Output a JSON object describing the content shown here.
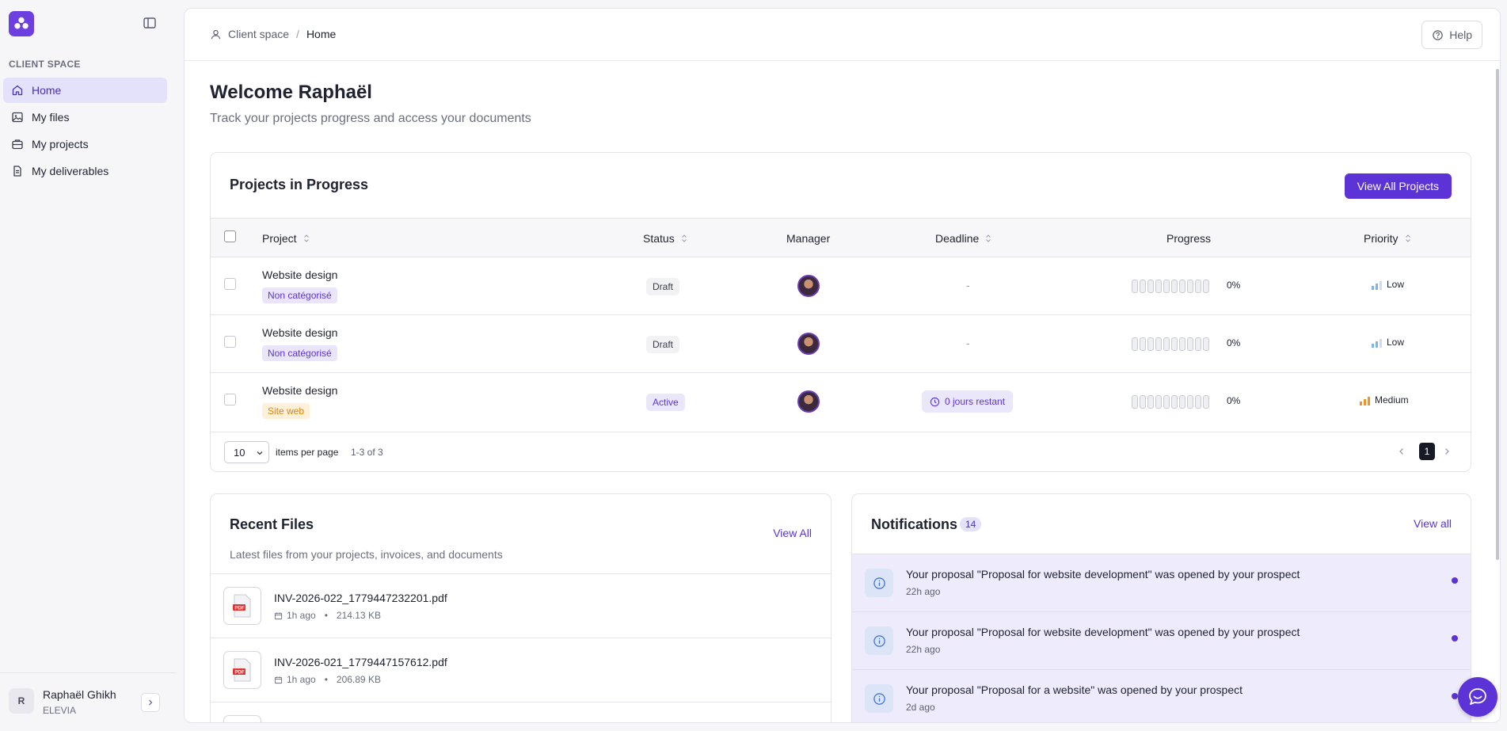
{
  "colors": {
    "accent": "#5b33d6",
    "nav_active_bg": "#e4e1fb",
    "priority_low": "#7fb4e8",
    "priority_medium": "#f39228"
  },
  "sidebar": {
    "section_label": "CLIENT SPACE",
    "items": [
      {
        "label": "Home",
        "icon": "home-icon",
        "active": true
      },
      {
        "label": "My files",
        "icon": "image-icon"
      },
      {
        "label": "My projects",
        "icon": "briefcase-icon"
      },
      {
        "label": "My deliverables",
        "icon": "document-icon"
      }
    ],
    "user": {
      "initial": "R",
      "name": "Raphaël Ghikh",
      "org": "ELEVIA"
    }
  },
  "topbar": {
    "breadcrumb": [
      "Client space",
      "Home"
    ],
    "separator": "/",
    "help_label": "Help"
  },
  "page": {
    "title": "Welcome Raphaël",
    "subtitle": "Track your projects progress and access your documents"
  },
  "projects": {
    "title": "Projects in Progress",
    "view_all_label": "View All Projects",
    "columns": {
      "project": "Project",
      "status": "Status",
      "manager": "Manager",
      "deadline": "Deadline",
      "progress": "Progress",
      "priority": "Priority"
    },
    "rows": [
      {
        "name": "Website design",
        "tag": "Non catégorisé",
        "status": "Draft",
        "deadline": "-",
        "progress": "0%",
        "priority": "Low"
      },
      {
        "name": "Website design",
        "tag": "Non catégorisé",
        "status": "Draft",
        "deadline": "-",
        "progress": "0%",
        "priority": "Low"
      },
      {
        "name": "Website design",
        "tag": "Site web",
        "status": "Active",
        "deadline": "0 jours restant",
        "progress": "0%",
        "priority": "Medium"
      }
    ],
    "per_page_value": "10",
    "per_page_label": "items per page",
    "range_label": "1-3 of 3",
    "current_page": "1"
  },
  "recent_files": {
    "title": "Recent Files",
    "subtitle": "Latest files from your projects, invoices, and documents",
    "view_all_label": "View All",
    "files": [
      {
        "name": "INV-2026-022_1779447232201.pdf",
        "time": "1h ago",
        "size": "214.13 KB"
      },
      {
        "name": "INV-2026-021_1779447157612.pdf",
        "time": "1h ago",
        "size": "206.89 KB"
      }
    ],
    "meta_separator": "•"
  },
  "notifications": {
    "title": "Notifications",
    "count": "14",
    "view_all_label": "View all",
    "items": [
      {
        "text": "Your proposal \"Proposal for website development\" was opened by your prospect",
        "time": "22h ago"
      },
      {
        "text": "Your proposal \"Proposal for website development\" was opened by your prospect",
        "time": "22h ago"
      },
      {
        "text": "Your proposal \"Proposal for a website\" was opened by your prospect",
        "time": "2d ago"
      }
    ]
  }
}
